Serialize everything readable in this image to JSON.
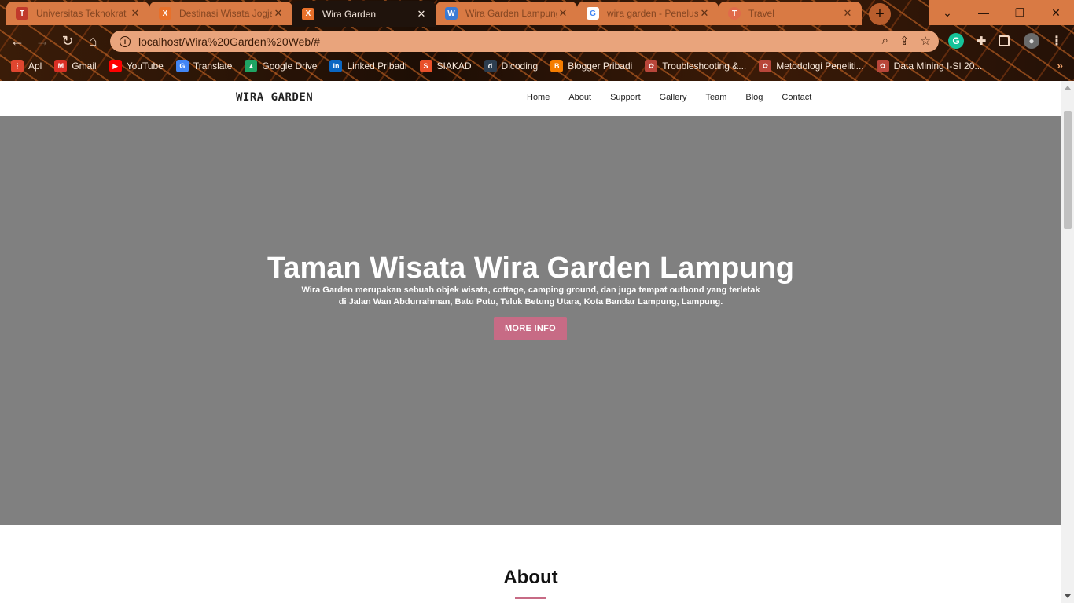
{
  "browser": {
    "tabs": [
      {
        "title": "Universitas Teknokrat",
        "icon": "teknokrat-icon",
        "color": "#c0392b",
        "glyph": "T"
      },
      {
        "title": "Destinasi Wisata Jogja",
        "icon": "xampp-icon",
        "color": "#e8702a",
        "glyph": "X"
      },
      {
        "title": "Wira Garden",
        "icon": "xampp-icon",
        "color": "#e8702a",
        "glyph": "X"
      },
      {
        "title": "Wira Garden Lampung",
        "icon": "shield-icon",
        "color": "#3b7bd4",
        "glyph": "W"
      },
      {
        "title": "wira garden - Penelusuran",
        "icon": "google-icon",
        "color": "#4285f4",
        "glyph": "G"
      },
      {
        "title": "Travel",
        "icon": "travel-icon",
        "color": "#e06a4a",
        "glyph": "T"
      }
    ],
    "url": "localhost/Wira%20Garden%20Web/#",
    "bookmarks": [
      {
        "label": "Apl",
        "icon": "apps-grid-icon",
        "color": "#e0462f",
        "glyph": "⋮"
      },
      {
        "label": "Gmail",
        "icon": "gmail-icon",
        "color": "#d93025",
        "glyph": "M"
      },
      {
        "label": "YouTube",
        "icon": "youtube-icon",
        "color": "#ff0000",
        "glyph": "▶"
      },
      {
        "label": "Translate",
        "icon": "translate-icon",
        "color": "#4285f4",
        "glyph": "G"
      },
      {
        "label": "Google Drive",
        "icon": "google-drive-icon",
        "color": "#1fa463",
        "glyph": "▲"
      },
      {
        "label": "Linked Pribadi",
        "icon": "linkedin-icon",
        "color": "#0a66c2",
        "glyph": "in"
      },
      {
        "label": "SIAKAD",
        "icon": "siakad-icon",
        "color": "#e8502a",
        "glyph": "S"
      },
      {
        "label": "Dicoding",
        "icon": "dicoding-icon",
        "color": "#2d3e50",
        "glyph": "d"
      },
      {
        "label": "Blogger Pribadi",
        "icon": "blogger-icon",
        "color": "#f57d00",
        "glyph": "B"
      },
      {
        "label": "Troubleshooting &...",
        "icon": "teknokrat-seal-icon",
        "color": "#b8463a",
        "glyph": "✿"
      },
      {
        "label": "Metodologi Peneliti...",
        "icon": "teknokrat-seal-icon",
        "color": "#b8463a",
        "glyph": "✿"
      },
      {
        "label": "Data Mining I-SI 20...",
        "icon": "teknokrat-seal-icon",
        "color": "#b8463a",
        "glyph": "✿"
      }
    ]
  },
  "site": {
    "brand": "WIRA GARDEN",
    "menu": [
      "Home",
      "About",
      "Support",
      "Gallery",
      "Team",
      "Blog",
      "Contact"
    ],
    "hero": {
      "title": "Taman Wisata Wira Garden Lampung",
      "desc_line1": "Wira Garden merupakan sebuah objek wisata, cottage, camping ground, dan juga tempat outbond yang terletak",
      "desc_line2": "di Jalan Wan Abdurrahman, Batu Putu, Teluk Betung Utara, Kota Bandar Lampung, Lampung.",
      "button": "MORE INFO"
    },
    "about": {
      "title": "About"
    },
    "accent": "#c76b85",
    "hero_bg": "#808080"
  }
}
